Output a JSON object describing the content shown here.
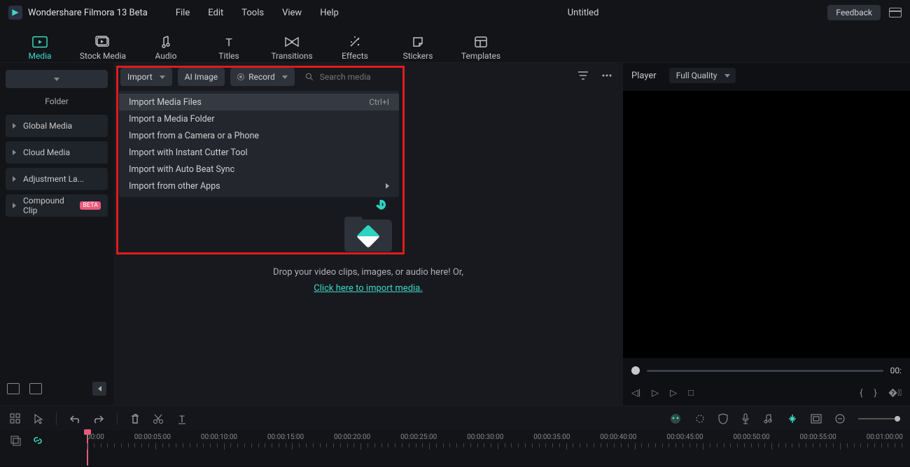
{
  "titlebar": {
    "app_name": "Wondershare Filmora 13 Beta",
    "menus": [
      "File",
      "Edit",
      "Tools",
      "View",
      "Help"
    ],
    "doc_title": "Untitled",
    "feedback": "Feedback"
  },
  "tabs": [
    {
      "label": "Media",
      "active": true
    },
    {
      "label": "Stock Media"
    },
    {
      "label": "Audio"
    },
    {
      "label": "Titles"
    },
    {
      "label": "Transitions"
    },
    {
      "label": "Effects"
    },
    {
      "label": "Stickers"
    },
    {
      "label": "Templates"
    }
  ],
  "sidebar": {
    "folder_label": "Folder",
    "items": [
      {
        "label": "Global Media"
      },
      {
        "label": "Cloud Media"
      },
      {
        "label": "Adjustment La..."
      },
      {
        "label": "Compound Clip",
        "badge": "BETA"
      }
    ]
  },
  "media_toolbar": {
    "import": "Import",
    "ai_image": "AI Image",
    "record": "Record",
    "search_placeholder": "Search media"
  },
  "import_menu": [
    {
      "label": "Import Media Files",
      "shortcut": "Ctrl+I",
      "hover": true
    },
    {
      "label": "Import a Media Folder"
    },
    {
      "label": "Import from a Camera or a Phone"
    },
    {
      "label": "Import with Instant Cutter Tool"
    },
    {
      "label": "Import with Auto Beat Sync"
    },
    {
      "label": "Import from other Apps",
      "submenu": true
    }
  ],
  "drop_area": {
    "text": "Drop your video clips, images, or audio here! Or,",
    "link": "Click here to import media."
  },
  "preview": {
    "player_label": "Player",
    "quality": "Full Quality",
    "time": "00:"
  },
  "timeline": {
    "marks": [
      "00:00",
      "00:00:05:00",
      "00:00:10:00",
      "00:00:15:00",
      "00:00:20:00",
      "00:00:25:00",
      "00:00:30:00",
      "00:00:35:00",
      "00:00:40:00",
      "00:00:45:00",
      "00:00:50:00",
      "00:00:55:00",
      "00:01:00:00"
    ]
  }
}
